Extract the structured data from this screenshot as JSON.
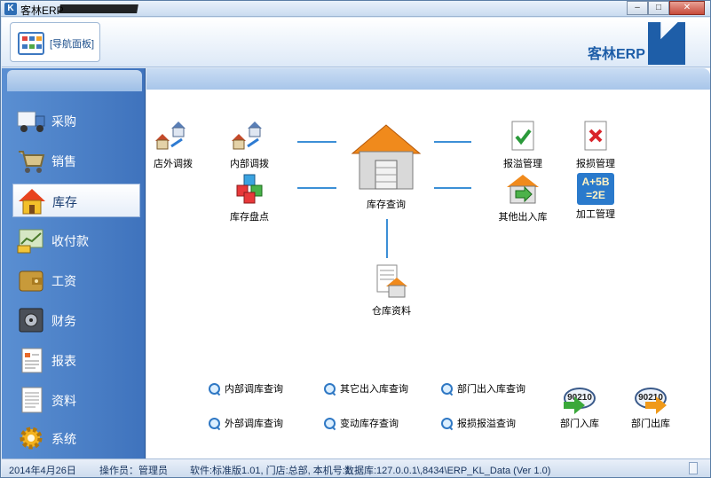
{
  "window": {
    "title": "客林ERP",
    "controls": {
      "minimize": "–",
      "maximize": "□",
      "close": "✕"
    }
  },
  "toolbar": {
    "nav_tab_label": "[导航面板]",
    "brand": "客林ERP"
  },
  "sidebar": {
    "items": [
      {
        "label": "采购",
        "icon": "truck-icon"
      },
      {
        "label": "销售",
        "icon": "shopping-cart-icon"
      },
      {
        "label": "库存",
        "icon": "warehouse-house-icon"
      },
      {
        "label": "收付款",
        "icon": "cash-icon"
      },
      {
        "label": "工资",
        "icon": "wallet-icon"
      },
      {
        "label": "财务",
        "icon": "safe-icon"
      },
      {
        "label": "报表",
        "icon": "report-icon"
      },
      {
        "label": "资料",
        "icon": "document-icon"
      },
      {
        "label": "系统",
        "icon": "gear-icon"
      }
    ],
    "active_index": 2
  },
  "main": {
    "nodes": {
      "store_transfer": "店外调拨",
      "internal_transfer": "内部调拨",
      "inventory_count": "库存盘点",
      "inventory_query": "库存查询",
      "overflow_mgmt": "报溢管理",
      "loss_mgmt": "报损管理",
      "other_inout": "其他出入库",
      "processing_mgmt": "加工管理",
      "warehouse_data": "仓库资料",
      "processing_icon_text": "A+5B =2E"
    },
    "links": [
      "内部调库查询",
      "其它出入库查询",
      "部门出入库查询",
      "外部调库查询",
      "变动库存查询",
      "报损报溢查询"
    ],
    "dept": {
      "in_label": "部门入库",
      "out_label": "部门出库",
      "in_badge": "90210",
      "out_badge": "90210"
    }
  },
  "status": {
    "date": "2014年4月26日",
    "operator": "操作员：管理员",
    "info": "软件:标准版1.01, 门店:总部, 本机号:1,",
    "database": "数据库:127.0.0.1\\,8434\\ERP_KL_Data (Ver 1.0)"
  },
  "colors": {
    "sidebar_bg": "#4a80c8",
    "accent": "#1e5ea8",
    "connector": "#3c8fd6",
    "house_roof": "#f08a1c"
  }
}
